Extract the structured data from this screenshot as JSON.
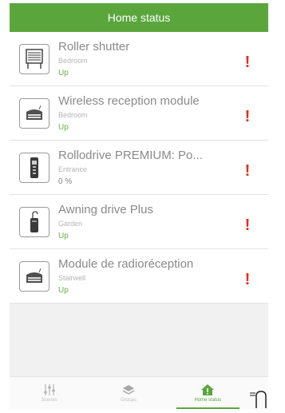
{
  "header": {
    "title": "Home status"
  },
  "devices": [
    {
      "title": "Roller shutter",
      "room": "Bedroom",
      "status": "Up",
      "icon": "roller-shutter-icon",
      "alert": "!"
    },
    {
      "title": "Wireless reception module",
      "room": "Bedroom",
      "status": "Up",
      "icon": "reception-module-icon",
      "alert": "!"
    },
    {
      "title": "Rollodrive PREMIUM: Po...",
      "room": "Entrance",
      "status": "0 %",
      "icon": "belt-winder-icon",
      "alert": "!"
    },
    {
      "title": "Awning drive Plus",
      "room": "Garden",
      "status": "Up",
      "icon": "awning-drive-icon",
      "alert": "!"
    },
    {
      "title": "Module de radioréception",
      "room": "Stairwell",
      "status": "Up",
      "icon": "reception-module-icon",
      "alert": "!"
    }
  ],
  "tabbar": {
    "tabs": [
      {
        "label": "Scenes",
        "icon": "sliders-icon",
        "active": false
      },
      {
        "label": "Groups",
        "icon": "groups-icon",
        "active": false
      },
      {
        "label": "Home status",
        "icon": "home-alert-icon",
        "active": true
      }
    ]
  },
  "colors": {
    "accent": "#5aa63c",
    "alert": "#e52d1d",
    "status": "#6db044"
  }
}
